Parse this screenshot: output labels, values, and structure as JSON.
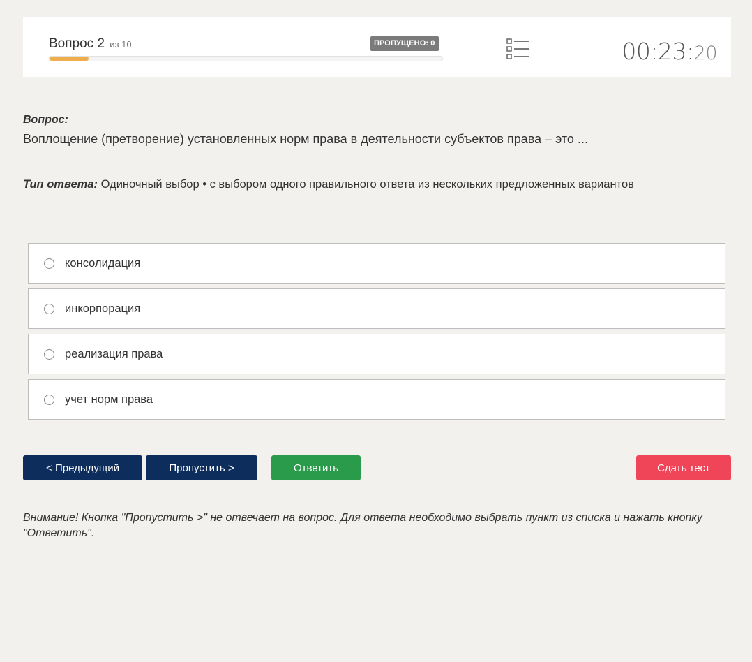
{
  "header": {
    "question_prefix": "Вопрос 2",
    "question_of": "из 10",
    "skipped_badge": "ПРОПУЩЕНО: 0",
    "progress_fraction": 0.1,
    "timer_main": "00:23:",
    "timer_seconds": "20",
    "list_icon": "list-icon"
  },
  "question": {
    "label": "Вопрос:",
    "text": "Воплощение (претворение) установленных норм права в деятельности субъектов права – это ..."
  },
  "answer_type": {
    "label": "Тип ответа:",
    "value": " Одиночный выбор • с выбором одного правильного ответа из нескольких предложенных вариантов"
  },
  "options": [
    {
      "label": "консолидация"
    },
    {
      "label": "инкорпорация"
    },
    {
      "label": "реализация права"
    },
    {
      "label": "учет норм права"
    }
  ],
  "buttons": {
    "prev": "< Предыдущий",
    "skip": "Пропустить >",
    "answer": "Ответить",
    "finish": "Сдать тест"
  },
  "colors": {
    "primary": "#0d2d5c",
    "answer": "#2a9a4b",
    "finish": "#f04458",
    "progress": "#f0ad4e",
    "badge": "#7b7b7b"
  },
  "notice": "Внимание! Кнопка \"Пропустить >\" не отвечает на вопрос. Для ответа необходимо выбрать пункт из списка и нажать кнопку \"Ответить\"."
}
